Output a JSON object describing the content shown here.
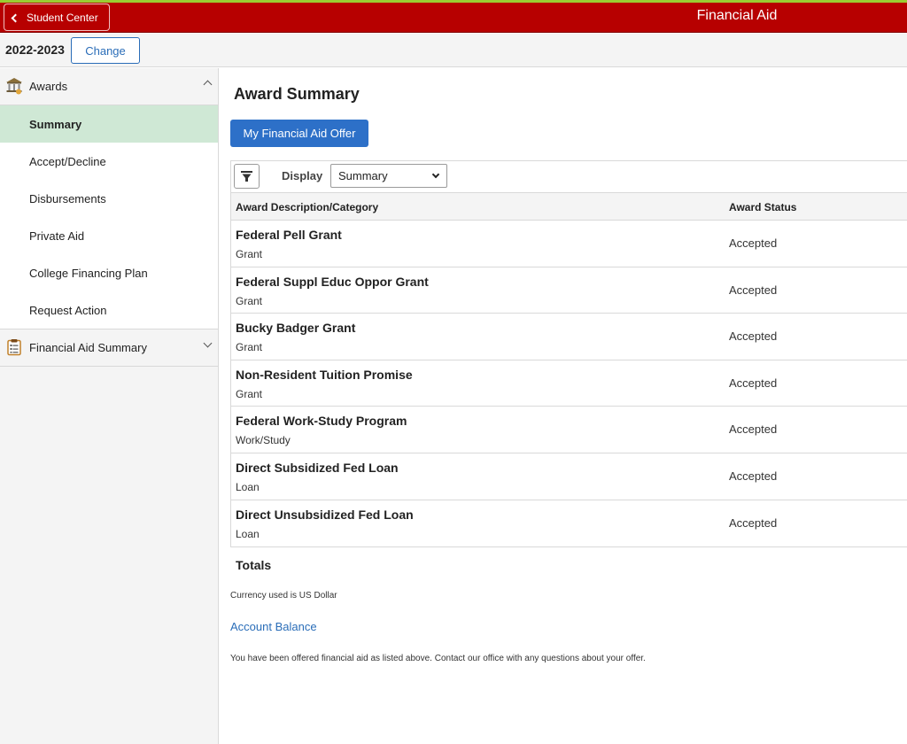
{
  "banner": {
    "back_label": "Student Center",
    "title": "Financial Aid",
    "color": "#b70000"
  },
  "term": {
    "label": "2022-2023",
    "change_label": "Change"
  },
  "sidebar": {
    "groups": [
      {
        "label": "Awards",
        "icon": "bank-icon",
        "expanded": true,
        "items": [
          {
            "label": "Summary",
            "active": true
          },
          {
            "label": "Accept/Decline"
          },
          {
            "label": "Disbursements"
          },
          {
            "label": "Private Aid"
          },
          {
            "label": "College Financing Plan"
          },
          {
            "label": "Request Action"
          }
        ]
      },
      {
        "label": "Financial Aid Summary",
        "icon": "clipboard-icon",
        "expanded": false
      }
    ]
  },
  "main": {
    "title": "Award Summary",
    "offer_button": "My Financial Aid Offer",
    "display_label": "Display",
    "display_value": "Summary",
    "columns": [
      "Award Description/Category",
      "Award Status"
    ],
    "rows": [
      {
        "name": "Federal Pell Grant",
        "category": "Grant",
        "status": "Accepted"
      },
      {
        "name": "Federal Suppl Educ Oppor Grant",
        "category": "Grant",
        "status": "Accepted"
      },
      {
        "name": "Bucky Badger Grant",
        "category": "Grant",
        "status": "Accepted"
      },
      {
        "name": "Non-Resident Tuition Promise",
        "category": "Grant",
        "status": "Accepted"
      },
      {
        "name": "Federal Work-Study Program",
        "category": "Work/Study",
        "status": "Accepted"
      },
      {
        "name": "Direct Subsidized Fed Loan",
        "category": "Loan",
        "status": "Accepted"
      },
      {
        "name": "Direct Unsubsidized Fed Loan",
        "category": "Loan",
        "status": "Accepted"
      }
    ],
    "totals_label": "Totals",
    "currency_note": "Currency used is US Dollar",
    "account_balance_link": "Account Balance",
    "notice": "You have been offered financial aid as listed above. Contact our office with any questions about your offer."
  }
}
